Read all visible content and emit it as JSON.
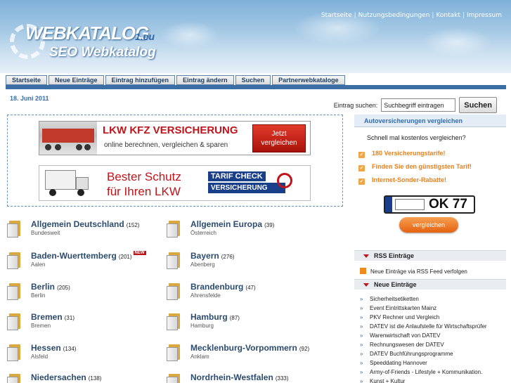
{
  "header": {
    "logo_title": "WEBKATALOG",
    "logo_tld": "1.eu",
    "logo_subtitle": "SEO Webkatalog",
    "toplinks": [
      "Startseite",
      "Nutzungsbedingungen",
      "Kontakt",
      "Impressum"
    ]
  },
  "nav": {
    "tabs": [
      "Startseite",
      "Neue Einträge",
      "Eintrag hinzufügen",
      "Eintrag ändern",
      "Suchen",
      "Partnerwebkataloge"
    ]
  },
  "date": "18. Juni 2011",
  "search": {
    "label": "Eintrag suchen:",
    "value": "Suchbegriff eintragen",
    "button": "Suchen"
  },
  "ads": {
    "ad1": {
      "headline": "LKW KFZ VERSICHERUNG",
      "subline": "online berechnen, vergleichen & sparen",
      "cta_line1": "Jetzt",
      "cta_line2": "vergleichen"
    },
    "ad2": {
      "line1": "Bester Schutz",
      "line2": "für Ihren LKW",
      "brand1": "TARIF CHECK",
      "brand2": "VERSICHERUNG"
    }
  },
  "categories": [
    {
      "name": "Allgemein Deutschland",
      "count": "(152)",
      "sub": "Bundesweit",
      "new": ""
    },
    {
      "name": "Allgemein Europa",
      "count": "(39)",
      "sub": "Österreich",
      "new": ""
    },
    {
      "name": "Baden-Wuerttemberg",
      "count": "(201)",
      "sub": "Aalen",
      "new": "NEW"
    },
    {
      "name": "Bayern",
      "count": "(276)",
      "sub": "Abenberg",
      "new": ""
    },
    {
      "name": "Berlin",
      "count": "(205)",
      "sub": "Berlin",
      "new": ""
    },
    {
      "name": "Brandenburg",
      "count": "(47)",
      "sub": "Ahrensfelde",
      "new": ""
    },
    {
      "name": "Bremen",
      "count": "(31)",
      "sub": "Bremen",
      "new": ""
    },
    {
      "name": "Hamburg",
      "count": "(87)",
      "sub": "Hamburg",
      "new": ""
    },
    {
      "name": "Hessen",
      "count": "(134)",
      "sub": "Alsfeld",
      "new": ""
    },
    {
      "name": "Mecklenburg-Vorpommern",
      "count": "(92)",
      "sub": "Anklam",
      "new": ""
    },
    {
      "name": "Niedersachen",
      "count": "(138)",
      "sub": "",
      "new": ""
    },
    {
      "name": "Nordrhein-Westfalen",
      "count": "(333)",
      "sub": "",
      "new": ""
    }
  ],
  "sidebar": {
    "header": "Autoversicherungen vergleichen",
    "question": "Schnell mal kostenlos vergleichen?",
    "bullets": [
      "180 Versicherungstarife!",
      "Finden Sie den günstigsten Tarif!",
      "Internet-Sonder-Rabatte!"
    ],
    "plate_text": "OK 77",
    "compare_button": "vergleichen",
    "rss_title": "RSS Einträge",
    "rss_link": "Neue Einträge via RSS Feed verfolgen",
    "new_title": "Neue Einträge",
    "new_entries": [
      "Sicherheitsetiketten",
      "Event Eintrittskarten Mainz",
      "PKV Rechner und Vergleich",
      "DATEV ist die Anlaufstelle für Wirtschaftsprüfer",
      "Warenwirtschaft von DATEV",
      "Rechnungswesen der DATEV",
      "DATEV Buchführungsprogramme",
      "Speeddating Hannover",
      "Army-of-Friends - Lifestyle + Kommunikation.",
      "Kunst + Kultur"
    ]
  },
  "colors": {
    "accent": "#3a6ea5",
    "nav_text": "#1d3f66",
    "ad_red": "#c0141a",
    "sidebar_orange": "#e8811c"
  }
}
